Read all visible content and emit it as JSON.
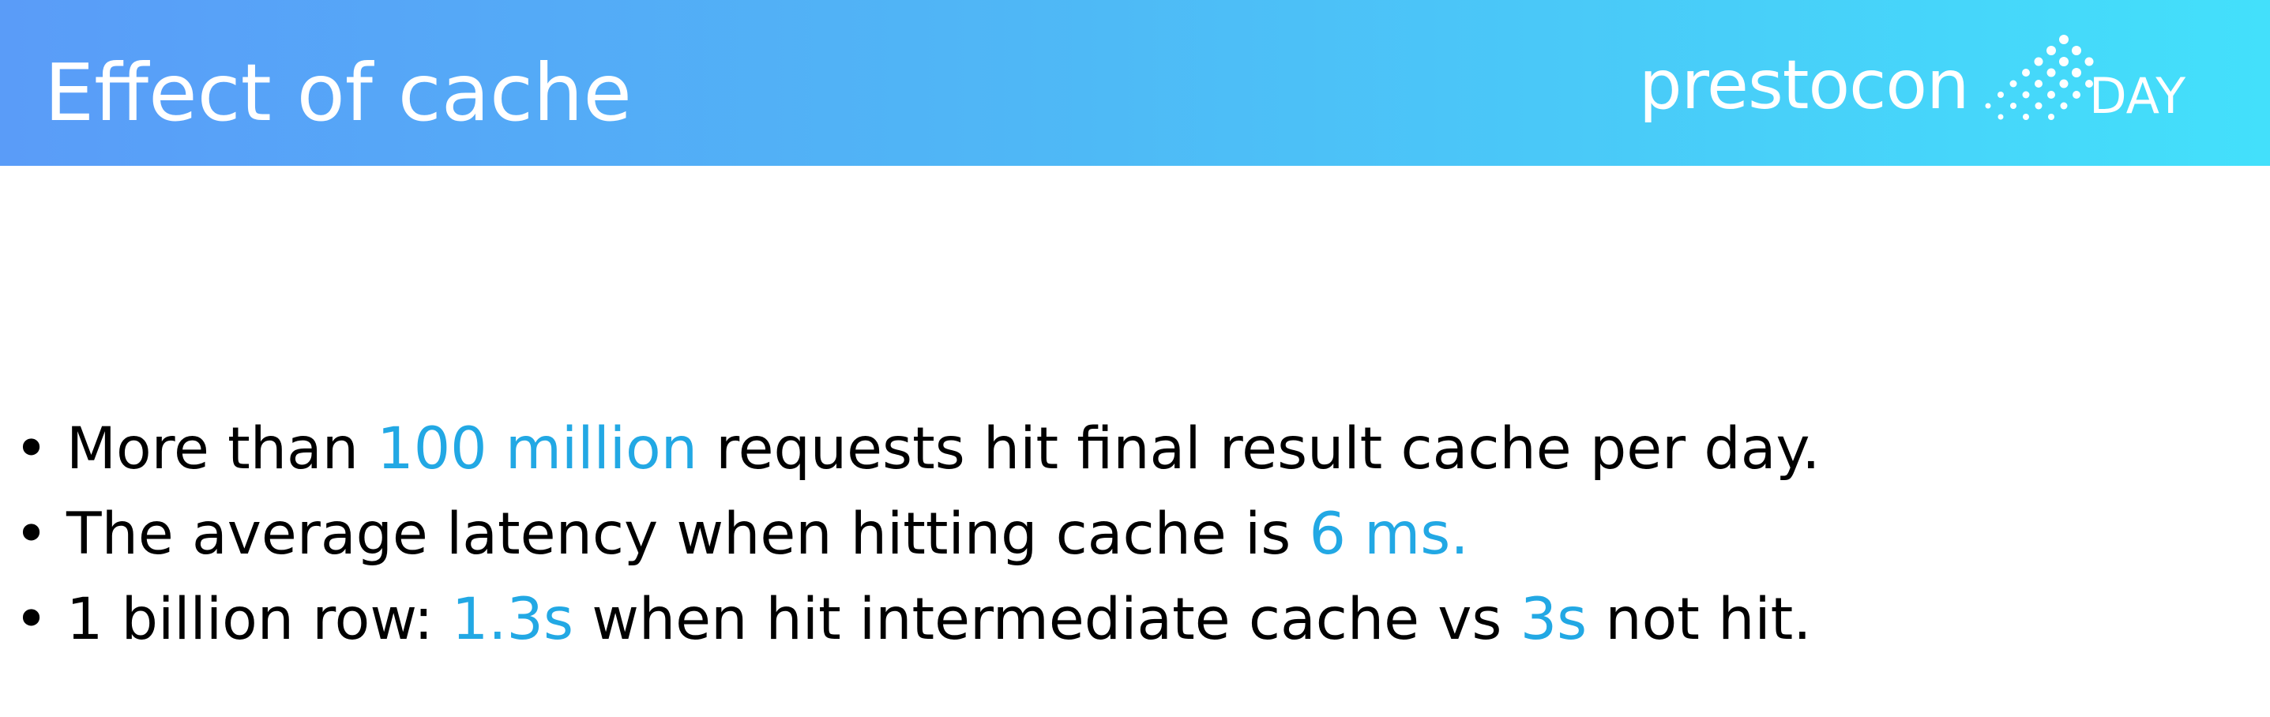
{
  "header": {
    "title": "Effect of cache",
    "logo": {
      "word": "prestocon",
      "suffix": "DAY",
      "icon": "dot-grid-logo-icon"
    }
  },
  "bullets": [
    {
      "marker": "•",
      "segments": [
        {
          "text": "More than ",
          "highlight": false
        },
        {
          "text": "100 million",
          "highlight": true
        },
        {
          "text": " requests  hit final result cache per day.",
          "highlight": false
        }
      ]
    },
    {
      "marker": "•",
      "segments": [
        {
          "text": "The average latency when hitting cache is ",
          "highlight": false
        },
        {
          "text": "6 ms.",
          "highlight": true
        }
      ]
    },
    {
      "marker": "•",
      "segments": [
        {
          "text": "1 billion row: ",
          "highlight": false
        },
        {
          "text": "1.3s",
          "highlight": true
        },
        {
          "text": " when hit intermediate cache vs ",
          "highlight": false
        },
        {
          "text": "3s",
          "highlight": true
        },
        {
          "text": " not hit.",
          "highlight": false
        }
      ]
    }
  ],
  "colors": {
    "highlight": "#22a8e4",
    "header_start": "#5a9cf8",
    "header_end": "#43e0fb",
    "text": "#000000"
  }
}
